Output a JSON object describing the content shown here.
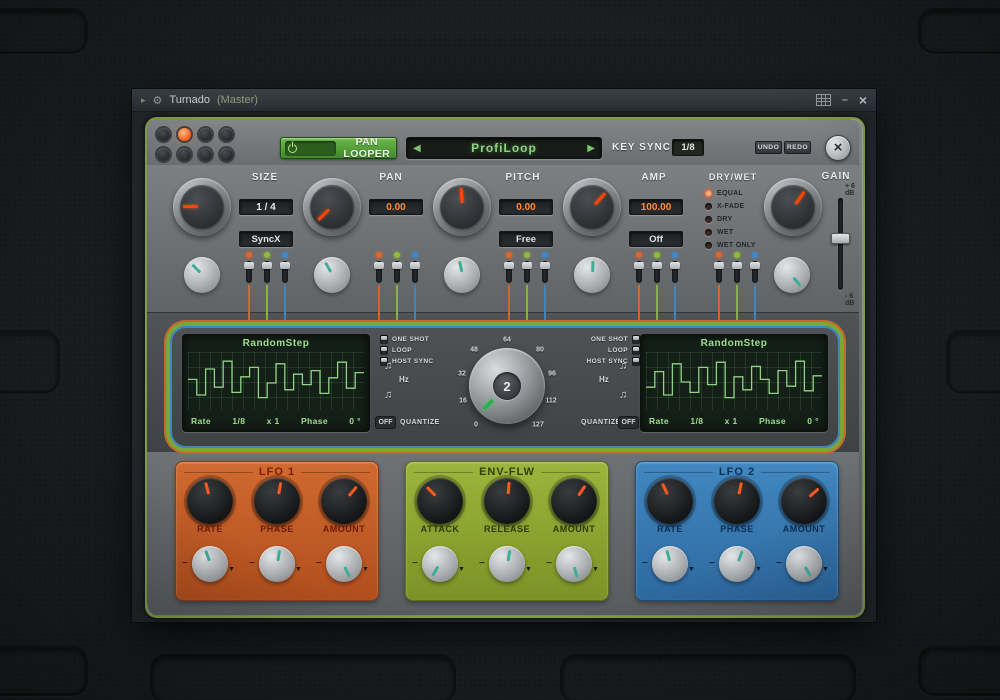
{
  "titlebar": {
    "title": "Turnado",
    "context": "(Master)"
  },
  "icons": {
    "detach": "▸",
    "gear": "⚙",
    "minimize": "–",
    "close": "×",
    "prev": "◀",
    "next": "▶",
    "note": "♫",
    "minus": "−",
    "triangle": "▼"
  },
  "header": {
    "mode_button": "PAN LOOPER",
    "preset": "ProfiLoop",
    "key_sync_label": "KEY SYNC",
    "key_sync_value": "1/8",
    "undo": "UNDO",
    "redo": "REDO"
  },
  "columns": [
    {
      "label": "SIZE",
      "value": "1 / 4",
      "mode": "SyncX"
    },
    {
      "label": "PAN",
      "value": "0.00",
      "mode": ""
    },
    {
      "label": "PITCH",
      "value": "0.00",
      "mode": "Free"
    },
    {
      "label": "AMP",
      "value": "100.00",
      "mode": "Off"
    }
  ],
  "drywet": {
    "label": "DRY/WET",
    "options": [
      "EQUAL",
      "X-FADE",
      "DRY",
      "WET",
      "WET ONLY"
    ],
    "selected_index": 0
  },
  "gain": {
    "label": "GAIN",
    "max_label": "+ 6 dB",
    "min_label": "- 6 dB"
  },
  "mod": {
    "toggles": [
      "ONE SHOT",
      "LOOP",
      "HOST SYNC"
    ],
    "hz_label": "Hz",
    "quantize_label": "QUANTIZE",
    "quantize_value": "OFF",
    "knob_value": "2",
    "scale": [
      "0",
      "16",
      "32",
      "48",
      "64",
      "80",
      "96",
      "112",
      "127"
    ],
    "left_display": {
      "title": "RandomStep",
      "rate_label": "Rate",
      "rate_value": "1/8",
      "mult_value": "x 1",
      "phase_label": "Phase",
      "phase_value": "0 °",
      "steps": [
        55,
        25,
        75,
        40,
        90,
        30,
        60,
        78,
        20,
        48,
        85,
        35,
        65,
        45,
        72,
        28,
        58,
        88,
        38,
        68
      ]
    },
    "right_display": {
      "title": "RandomStep",
      "rate_label": "Rate",
      "rate_value": "1/8",
      "mult_value": "x 1",
      "phase_label": "Phase",
      "phase_value": "0 °",
      "steps": [
        40,
        70,
        25,
        85,
        50,
        30,
        78,
        45,
        88,
        20,
        60,
        35,
        80,
        55,
        28,
        72,
        42,
        90,
        33,
        62
      ]
    }
  },
  "panels": [
    {
      "title": "LFO 1",
      "knobs": [
        "RATE",
        "PHASE",
        "AMOUNT"
      ]
    },
    {
      "title": "ENV-FLW",
      "knobs": [
        "ATTACK",
        "RELEASE",
        "AMOUNT"
      ]
    },
    {
      "title": "LFO 2",
      "knobs": [
        "RATE",
        "PHASE",
        "AMOUNT"
      ]
    }
  ],
  "colors": {
    "lfo1": "#E0662A",
    "env": "#8FBA3C",
    "lfo2": "#3F88C4",
    "lcd_text": "#8FD483",
    "value_text": "#FF8A3C"
  }
}
